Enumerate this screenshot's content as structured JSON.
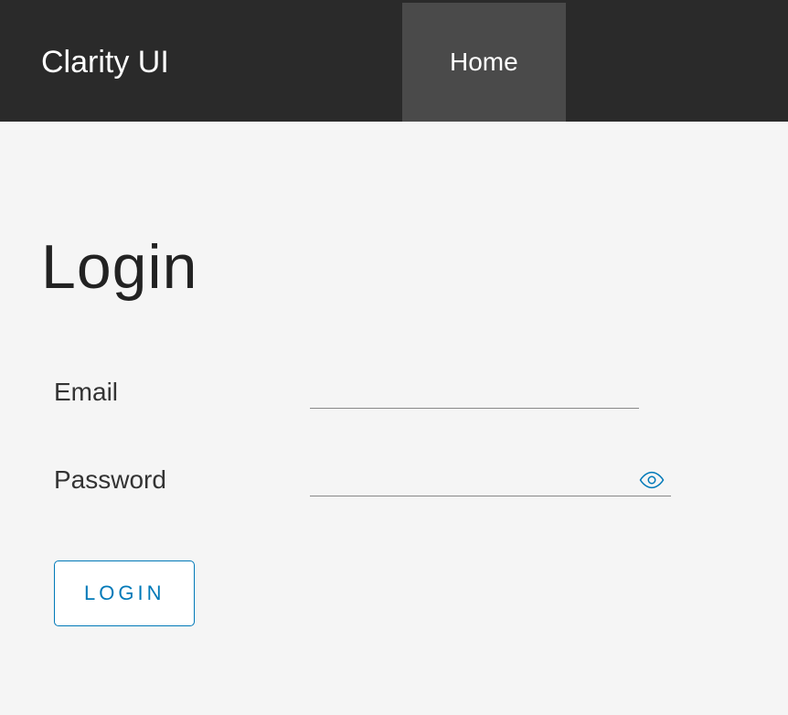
{
  "header": {
    "brand": "Clarity UI",
    "nav": {
      "home": "Home"
    }
  },
  "page": {
    "title": "Login"
  },
  "form": {
    "email_label": "Email",
    "email_value": "",
    "password_label": "Password",
    "password_value": "",
    "login_button": "LOGIN"
  },
  "icons": {
    "eye": "eye-icon"
  }
}
